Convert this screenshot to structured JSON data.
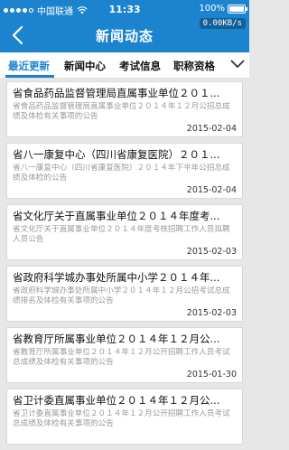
{
  "status_bar": {
    "carrier": "中国联通",
    "time": "11:33",
    "battery_percent": "100%",
    "battery_level": 1.0,
    "wifi_icon": "wifi-icon",
    "battery_icon": "battery-icon"
  },
  "speed_badge": "0.00KB/s",
  "nav": {
    "title": "新闻动态",
    "back_icon": "back-chevron-icon"
  },
  "tabs": [
    {
      "label": "最近更新",
      "active": true
    },
    {
      "label": "新闻中心",
      "active": false
    },
    {
      "label": "考试信息",
      "active": false
    },
    {
      "label": "职称资格",
      "active": false
    }
  ],
  "more_icon": "chevron-down-icon",
  "accent_color": "#1c84cf",
  "news": [
    {
      "title": "省食品药品监督管理局直属事业单位２０１...",
      "desc": "省食品药品监督管理局直属事业单位２０１４年１２月公招总成绩及体检有关事项的公告",
      "date": "2015-02-04"
    },
    {
      "title": "省八一康复中心（四川省康复医院）２０１...",
      "desc": "省八一康复中心（四川省康复医院）２０１４年下半年公招总成绩及体检的公告",
      "date": "2015-02-04"
    },
    {
      "title": "省文化厅关于直属事业单位２０１４年度考...",
      "desc": "省文化厅关于直属事业单位２０１４年度考核招聘工作人员拟聘人员公告",
      "date": "2015-02-03"
    },
    {
      "title": "省政府科学城办事处所属中小学２０１４年...",
      "desc": "省政府科学城办事处所属中小学２０１４年１２月公招考试总成绩排名及体检有关事项的公告",
      "date": "2015-02-03"
    },
    {
      "title": "省教育厅所属事业单位２０１４年１２月公...",
      "desc": "省教育厅所属事业单位２０１４年１２月公开招聘工作人员考试总成绩及体检有关事项的公告",
      "date": "2015-01-30"
    },
    {
      "title": "省卫计委直属事业单位２０１４年１２月公...",
      "desc": "省卫计委直属事业单位２０１４年１２月公开招聘工作人员考试总成绩及体检有关事项的公告",
      "date": ""
    }
  ]
}
